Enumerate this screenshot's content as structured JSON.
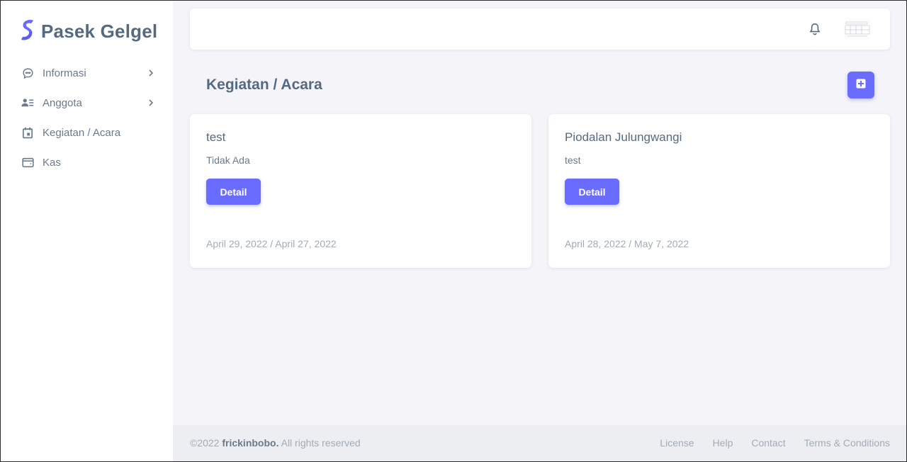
{
  "brand": {
    "name": "Pasek Gelgel",
    "logo_icon": "s-logo-icon",
    "accent": "#696cff"
  },
  "sidebar": {
    "items": [
      {
        "label": "Informasi",
        "icon": "chat-bubble-icon",
        "has_submenu": true
      },
      {
        "label": "Anggota",
        "icon": "user-list-icon",
        "has_submenu": true
      },
      {
        "label": "Kegiatan / Acara",
        "icon": "calendar-icon",
        "has_submenu": false
      },
      {
        "label": "Kas",
        "icon": "wallet-icon",
        "has_submenu": false
      }
    ]
  },
  "navbar": {
    "notification_icon": "bell-icon",
    "avatar_icon": "avatar-image"
  },
  "page": {
    "title": "Kegiatan / Acara",
    "add_icon": "plus-square-icon"
  },
  "cards": [
    {
      "title": "test",
      "description": "Tidak Ada",
      "button_label": "Detail",
      "dates": "April 29, 2022 / April 27, 2022"
    },
    {
      "title": "Piodalan Julungwangi",
      "description": "test",
      "button_label": "Detail",
      "dates": "April 28, 2022 / May 7, 2022"
    }
  ],
  "footer": {
    "copyright_prefix": "©2022 ",
    "copyright_brand": "frickinbobo.",
    "copyright_suffix": " All rights reserved",
    "links": [
      "License",
      "Help",
      "Contact",
      "Terms & Conditions"
    ]
  }
}
